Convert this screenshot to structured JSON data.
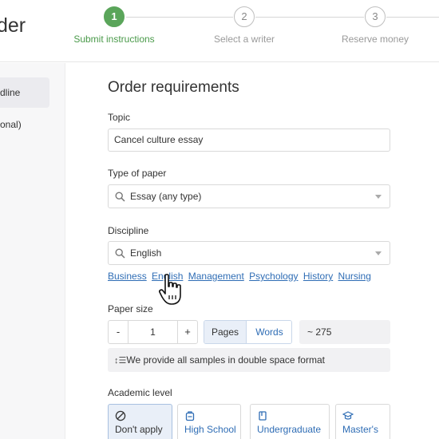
{
  "header": {
    "title": "der",
    "steps": [
      {
        "number": "1",
        "label": "Submit instructions",
        "state": "active"
      },
      {
        "number": "2",
        "label": "Select a writer",
        "state": "inactive"
      },
      {
        "number": "3",
        "label": "Reserve money",
        "state": "inactive"
      }
    ]
  },
  "sidebar": {
    "items": [
      {
        "label": "dline"
      },
      {
        "label": "onal)"
      }
    ]
  },
  "main": {
    "title": "Order requirements",
    "topic": {
      "label": "Topic",
      "value": "Cancel culture essay"
    },
    "paper_type": {
      "label": "Type of paper",
      "value": "Essay (any type)"
    },
    "discipline": {
      "label": "Discipline",
      "value": "English",
      "quick_links": [
        "Business",
        "English",
        "Management",
        "Psychology",
        "History",
        "Nursing"
      ]
    },
    "paper_size": {
      "label": "Paper size",
      "minus": "-",
      "plus": "+",
      "value": "1",
      "unit_pages": "Pages",
      "unit_words": "Words",
      "word_estimate": "~ 275",
      "notice": "We provide all samples in double space format"
    },
    "academic_level": {
      "label": "Academic level",
      "options": [
        "Don't apply",
        "High School",
        "Undergraduate",
        "Master's"
      ]
    }
  },
  "colors": {
    "accent_green": "#5aa55a",
    "link_blue": "#2f6db5",
    "selected_bg": "#e9eff8"
  }
}
